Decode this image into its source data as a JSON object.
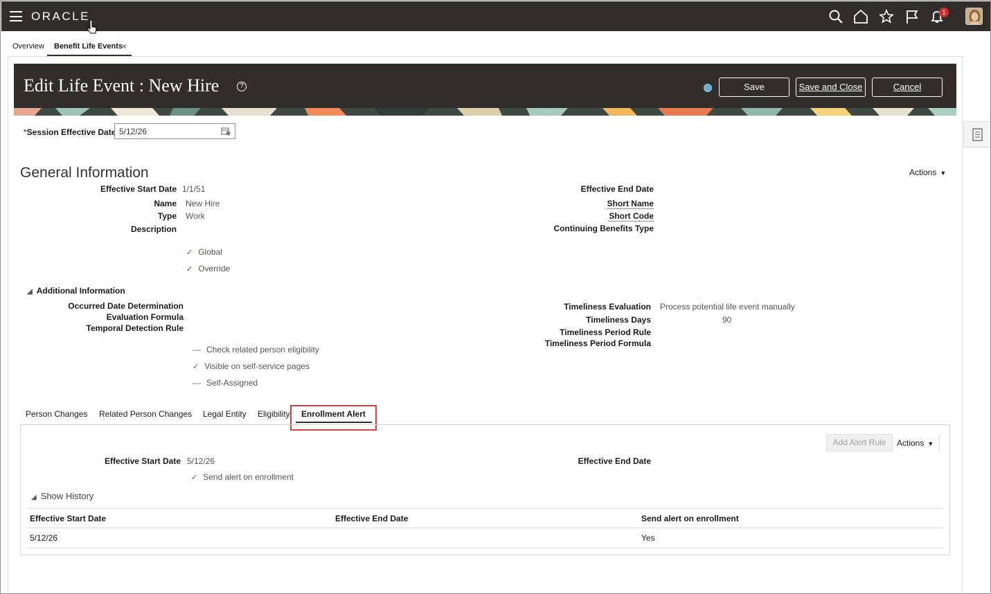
{
  "topbar": {
    "logo": "ORACLE",
    "notification_count": "1"
  },
  "app_tabs": [
    {
      "label": "Overview"
    },
    {
      "label": "Benefit Life Events",
      "close": "×"
    }
  ],
  "header": {
    "title": "Edit Life Event : New Hire",
    "help": "?",
    "save_label": "Save",
    "save_close_label": "Save and Close",
    "cancel_label": "Cancel"
  },
  "session": {
    "required_mark": "*",
    "label": "Session Effective Date",
    "value": "5/12/26"
  },
  "general": {
    "title": "General Information",
    "actions_label": "Actions",
    "effective_start_label": "Effective Start Date",
    "effective_start_value": "1/1/51",
    "name_label": "Name",
    "name_value": "New Hire",
    "type_label": "Type",
    "type_value": "Work",
    "description_label": "Description",
    "effective_end_label": "Effective End Date",
    "short_name_label": "Short Name",
    "short_code_label": "Short Code",
    "continuing_label": "Continuing Benefits Type",
    "global_label": "Global",
    "override_label": "Override"
  },
  "additional": {
    "title": "Additional Information",
    "occurred_label": "Occurred Date Determination",
    "eval_formula_label": "Evaluation Formula",
    "temporal_label": "Temporal Detection Rule",
    "timeliness_eval_label": "Timeliness Evaluation",
    "timeliness_eval_value": "Process potential life event manually",
    "timeliness_days_label": "Timeliness Days",
    "timeliness_days_value": "90",
    "timeliness_period_rule_label": "Timeliness Period Rule",
    "timeliness_period_formula_label": "Timeliness Period Formula",
    "check_related_label": "Check related person eligibility",
    "visible_self_service_label": "Visible on self-service pages",
    "self_assigned_label": "Self-Assigned"
  },
  "subtabs": [
    {
      "label": "Person Changes"
    },
    {
      "label": "Related Person Changes"
    },
    {
      "label": "Legal Entity"
    },
    {
      "label": "Eligibility"
    },
    {
      "label": "Enrollment Alert"
    }
  ],
  "alert_panel": {
    "add_rule_label": "Add Alert Rule",
    "actions_label": "Actions",
    "effective_start_label": "Effective Start Date",
    "effective_start_value": "5/12/26",
    "effective_end_label": "Effective End Date",
    "send_alert_label": "Send alert on enrollment",
    "history_label": "Show History",
    "table": {
      "columns": [
        "Effective Start Date",
        "Effective End Date",
        "Send alert on enrollment"
      ],
      "rows": [
        [
          "5/12/26",
          "",
          "Yes"
        ]
      ]
    }
  }
}
